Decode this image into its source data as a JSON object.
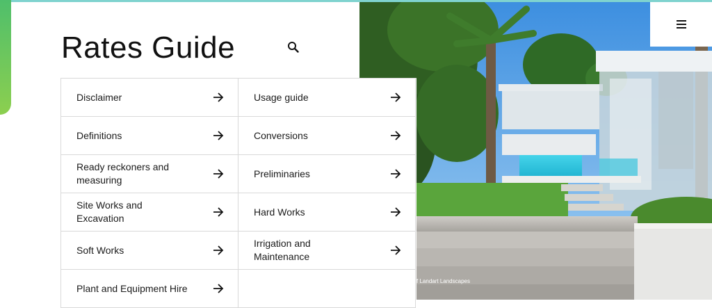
{
  "page": {
    "title": "Rates Guide"
  },
  "icons": {
    "search": "search-icon",
    "menu": "hamburger-menu-icon",
    "arrow": "arrow-right-icon"
  },
  "colors": {
    "accent_start": "#4fbf6b",
    "accent_end": "#8ccf4f",
    "top_line": "#7fd3cf",
    "border": "#d9d9d9",
    "text": "#1a1a1a"
  },
  "menu_items": [
    {
      "label": "Disclaimer"
    },
    {
      "label": "Usage guide"
    },
    {
      "label": "Definitions"
    },
    {
      "label": "Conversions"
    },
    {
      "label": "Ready reckoners and measuring"
    },
    {
      "label": "Preliminaries"
    },
    {
      "label": "Site Works and Excavation"
    },
    {
      "label": "Hard Works"
    },
    {
      "label": "Soft Works"
    },
    {
      "label": "Irrigation and Maintenance"
    },
    {
      "label": "Plant and Equipment Hire"
    }
  ],
  "hero": {
    "credit": "Photo courtesy of Landart Landscapes"
  }
}
